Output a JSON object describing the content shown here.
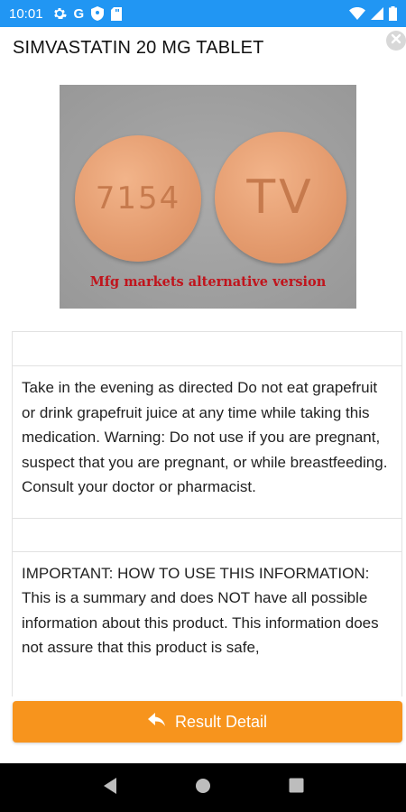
{
  "status_bar": {
    "time": "10:01",
    "left_icons": [
      "gear-icon",
      "google-icon",
      "shield-icon",
      "sd-card-icon"
    ],
    "right_icons": [
      "wifi-icon",
      "signal-icon",
      "battery-icon"
    ],
    "google_letter": "G"
  },
  "header": {
    "title": "SIMVASTATIN 20 MG TABLET"
  },
  "pill_image": {
    "imprint_left": "7154",
    "imprint_right": "TV",
    "caption": "Mfg markets alternative version",
    "caption_color": "#c0141c"
  },
  "content": {
    "directions": "Take in the evening as directed Do not eat grapefruit or drink grapefruit juice at any time while taking this medication. Warning: Do not use if you are pregnant, suspect that you are pregnant, or while breastfeeding. Consult your doctor or pharmacist.",
    "important": "IMPORTANT: HOW TO USE THIS INFORMATION: This is a summary and does NOT have all possible information about this product. This information does not assure that this product is safe,"
  },
  "action": {
    "result_detail_label": "Result Detail",
    "color": "#f7941d"
  },
  "colors": {
    "status_bar": "#2196f3",
    "nav_bar": "#000000"
  }
}
